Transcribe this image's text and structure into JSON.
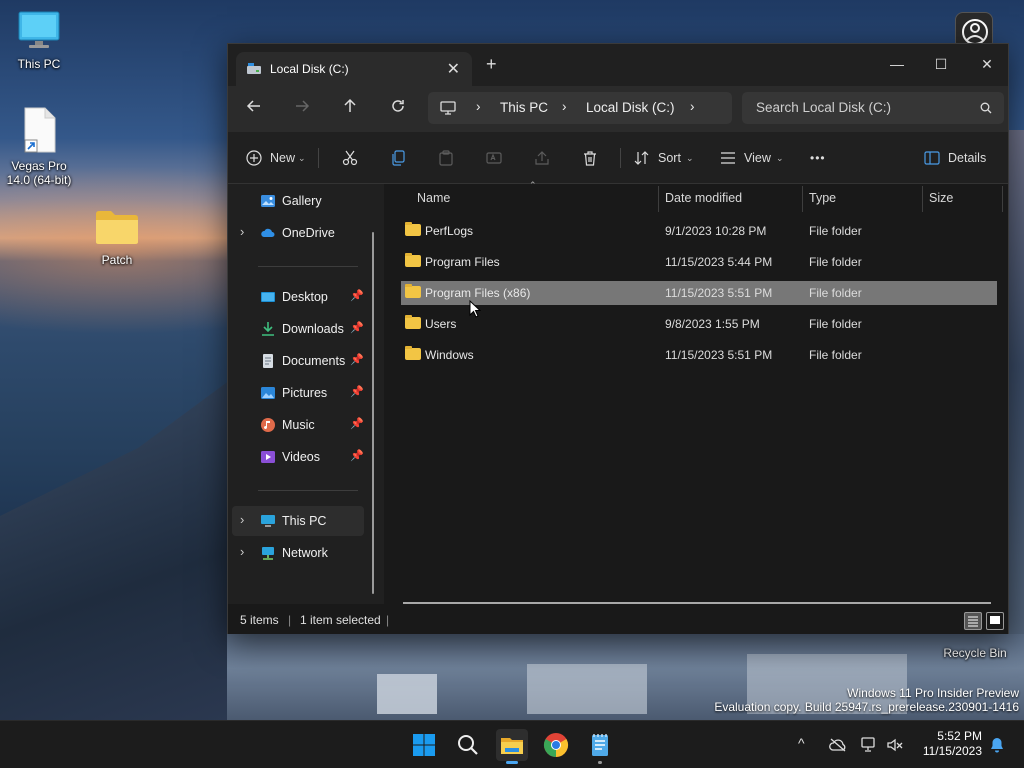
{
  "desktop": {
    "icons": [
      {
        "label": "This PC"
      },
      {
        "label": "Vegas Pro 14.0 (64-bit)"
      },
      {
        "label": "Patch"
      },
      {
        "label": "Recycle Bin"
      }
    ],
    "watermark": {
      "line1": "Windows 11 Pro Insider Preview",
      "line2": "Evaluation copy. Build 25947.rs_prerelease.230901-1416"
    }
  },
  "window": {
    "tab_title": "Local Disk (C:)",
    "close_tab": "✕",
    "new_tab": "+",
    "controls": {
      "minimize": "—",
      "maximize": "☐",
      "close": "✕"
    },
    "address": {
      "crumbs": [
        "This PC",
        "Local Disk (C:)"
      ],
      "separator": "›"
    },
    "search_placeholder": "Search Local Disk (C:)",
    "toolbar": {
      "new_label": "New",
      "sort_label": "Sort",
      "view_label": "View",
      "more_label": "•••",
      "details_label": "Details"
    },
    "sidebar": {
      "items": [
        {
          "label": "Gallery"
        },
        {
          "label": "OneDrive"
        },
        {
          "label": "Desktop"
        },
        {
          "label": "Downloads"
        },
        {
          "label": "Documents"
        },
        {
          "label": "Pictures"
        },
        {
          "label": "Music"
        },
        {
          "label": "Videos"
        },
        {
          "label": "This PC"
        },
        {
          "label": "Network"
        }
      ]
    },
    "columns": [
      "Name",
      "Date modified",
      "Type",
      "Size"
    ],
    "rows": [
      {
        "name": "PerfLogs",
        "date": "9/1/2023 10:28 PM",
        "type": "File folder"
      },
      {
        "name": "Program Files",
        "date": "11/15/2023 5:44 PM",
        "type": "File folder"
      },
      {
        "name": "Program Files (x86)",
        "date": "11/15/2023 5:51 PM",
        "type": "File folder"
      },
      {
        "name": "Users",
        "date": "9/8/2023 1:55 PM",
        "type": "File folder"
      },
      {
        "name": "Windows",
        "date": "11/15/2023 5:51 PM",
        "type": "File folder"
      }
    ],
    "status": {
      "items": "5 items",
      "selected": "1 item selected",
      "sep": "|"
    }
  },
  "taskbar": {
    "time": "5:52 PM",
    "date": "11/15/2023",
    "tray_chevron": "^"
  },
  "colors": {
    "accent": "#0078d4",
    "folder": "#f2c544",
    "selected_row": "#777777"
  }
}
